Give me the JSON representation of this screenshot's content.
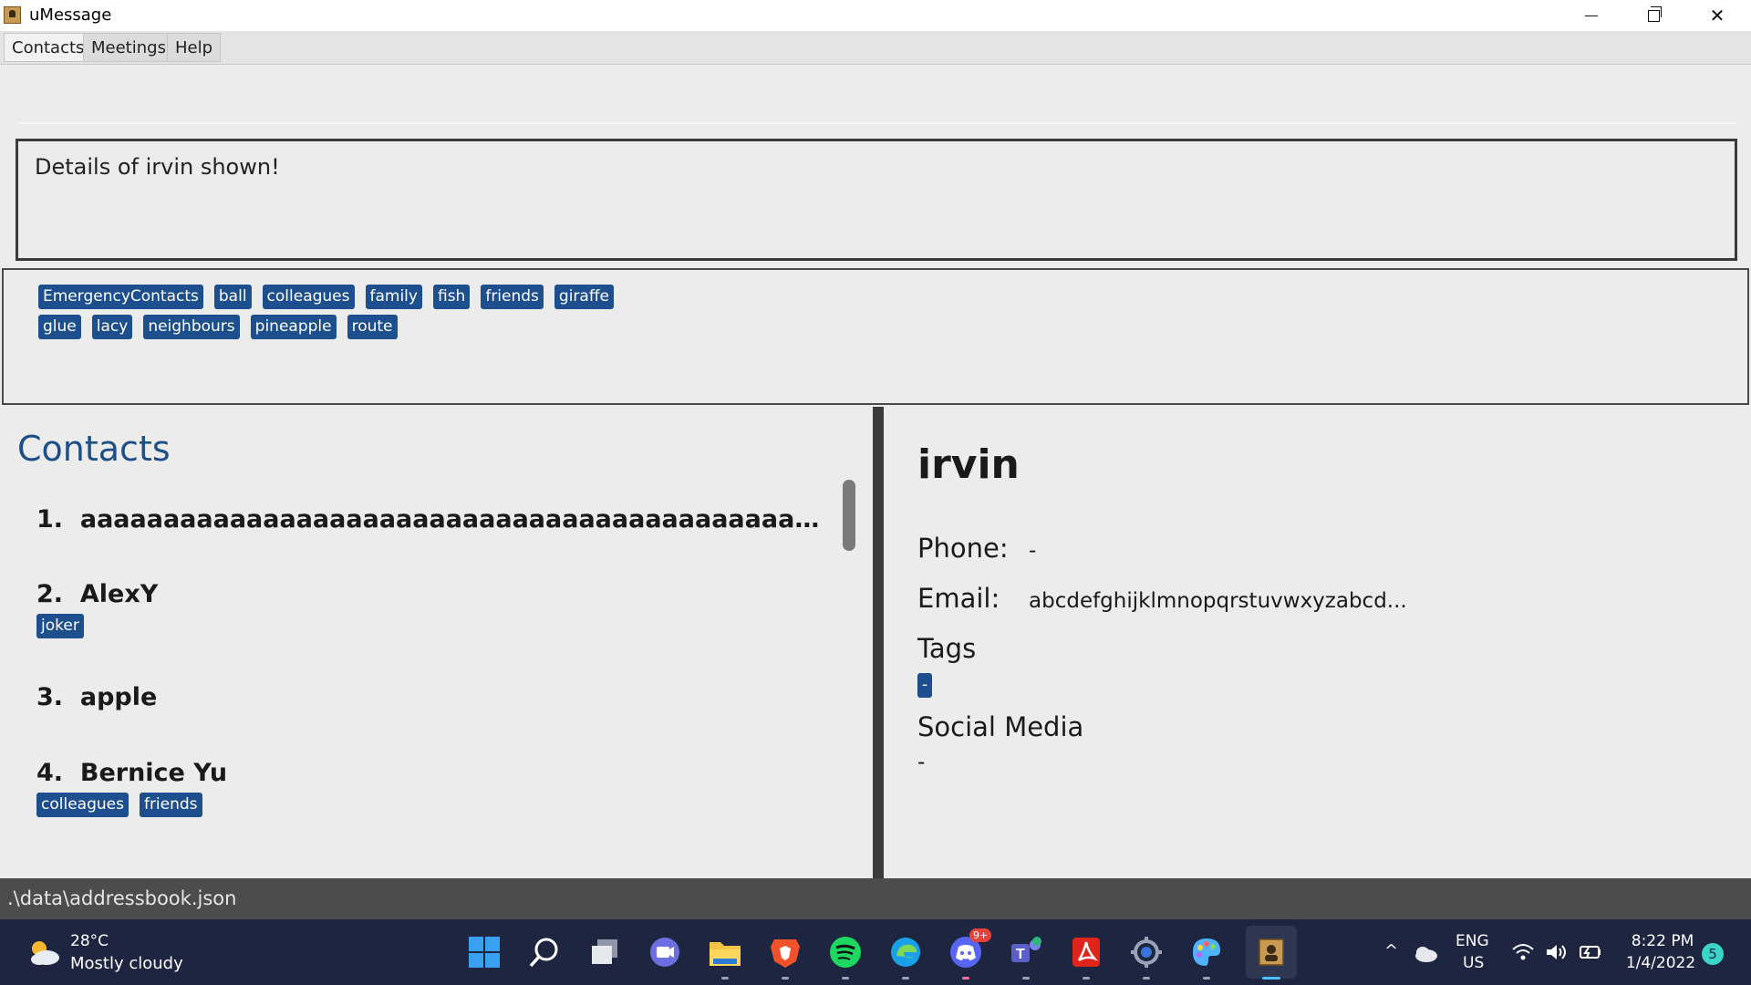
{
  "window": {
    "title": "uMessage"
  },
  "menu": [
    "Contacts",
    "Meetings",
    "Help"
  ],
  "result": {
    "message": "Details of irvin shown!"
  },
  "all_tags": {
    "row1": [
      "EmergencyContacts",
      "ball",
      "colleagues",
      "family",
      "fish",
      "friends",
      "giraffe"
    ],
    "row2": [
      "glue",
      "lacy",
      "neighbours",
      "pineapple",
      "route"
    ]
  },
  "contacts": {
    "title": "Contacts",
    "items": [
      {
        "index": "1.",
        "name": "aaaaaaaaaaaaaaaaaaaaaaaaaaaaaaaaaaaaaaaaaaaaaaaaaaaaaaaa...",
        "tags": []
      },
      {
        "index": "2.",
        "name": "AlexY",
        "tags": [
          "joker"
        ]
      },
      {
        "index": "3.",
        "name": "apple",
        "tags": []
      },
      {
        "index": "4.",
        "name": "Bernice Yu",
        "tags": [
          "colleagues",
          "friends"
        ]
      }
    ]
  },
  "detail": {
    "name": "irvin",
    "phone_label": "Phone:",
    "phone_value": "-",
    "email_label": "Email:",
    "email_value": "abcdefghijklmnopqrstuvwxyzabcd...",
    "tags_label": "Tags",
    "tags": [
      "-"
    ],
    "social_label": "Social Media",
    "social_value": "-"
  },
  "status": {
    "path": ".\\data\\addressbook.json"
  },
  "taskbar": {
    "weather_temp": "28°C",
    "weather_desc": "Mostly cloudy",
    "discord_badge": "9+",
    "lang_top": "ENG",
    "lang_bottom": "US",
    "time": "8:22 PM",
    "date": "1/4/2022",
    "notifications": "5"
  },
  "colors": {
    "tag_bg": "#1d4e8d",
    "contacts_title": "#1e4f86",
    "taskbar_bg": "#1d2540",
    "status_bg": "#4c4c4c"
  }
}
